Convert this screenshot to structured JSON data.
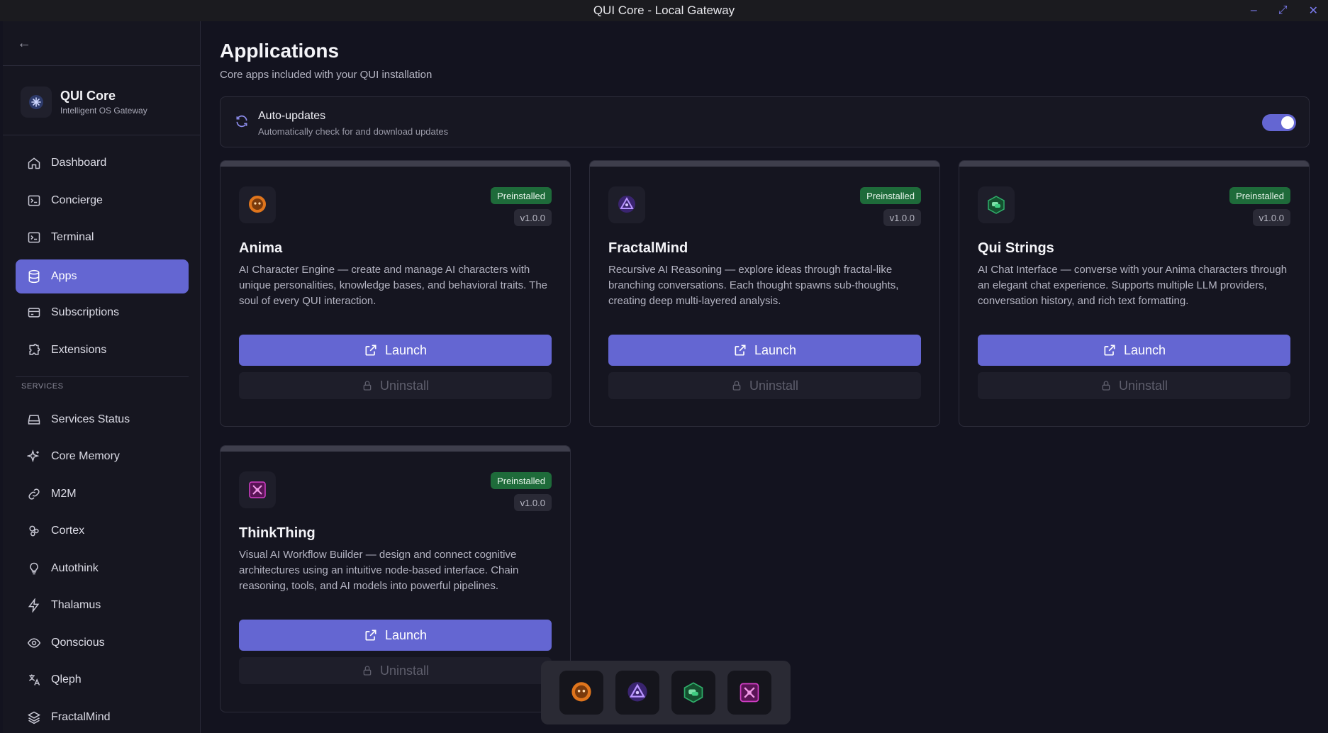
{
  "window": {
    "title": "QUI Core - Local Gateway",
    "controls": {
      "minimize": "–",
      "maximize": "⤢",
      "close": "✕"
    }
  },
  "sidebar": {
    "back_icon": "←",
    "brand": {
      "name": "QUI Core",
      "subtitle": "Intelligent OS Gateway"
    },
    "nav": [
      {
        "label": "Dashboard",
        "icon": "home-icon"
      },
      {
        "label": "Concierge",
        "icon": "terminal-box-icon"
      },
      {
        "label": "Terminal",
        "icon": "terminal-box-icon"
      },
      {
        "label": "Apps",
        "icon": "database-icon",
        "active": true
      },
      {
        "label": "Subscriptions",
        "icon": "card-icon"
      },
      {
        "label": "Extensions",
        "icon": "puzzle-icon"
      }
    ],
    "services_label": "SERVICES",
    "services": [
      {
        "label": "Services Status",
        "icon": "drive-icon"
      },
      {
        "label": "Core Memory",
        "icon": "sparkles-icon"
      },
      {
        "label": "M2M",
        "icon": "link-icon"
      },
      {
        "label": "Cortex",
        "icon": "nodes-icon"
      },
      {
        "label": "Autothink",
        "icon": "lightbulb-icon"
      },
      {
        "label": "Thalamus",
        "icon": "bolt-icon"
      },
      {
        "label": "Qonscious",
        "icon": "eye-icon"
      },
      {
        "label": "Qleph",
        "icon": "translate-icon"
      },
      {
        "label": "FractalMind",
        "icon": "layers-icon"
      }
    ]
  },
  "main": {
    "title": "Applications",
    "subtitle": "Core apps included with your QUI installation",
    "autoupdate": {
      "title": "Auto-updates",
      "description": "Automatically check for and download updates",
      "enabled": true
    },
    "apps": [
      {
        "name": "Anima",
        "badge": "Preinstalled",
        "version": "v1.0.0",
        "description": "AI Character Engine — create and manage AI characters with unique personalities, knowledge bases, and behavioral traits. The soul of every QUI interaction.",
        "launch": "Launch",
        "uninstall": "Uninstall",
        "icon": "anima-icon",
        "color": "#e0751c"
      },
      {
        "name": "FractalMind",
        "badge": "Preinstalled",
        "version": "v1.0.0",
        "description": "Recursive AI Reasoning — explore ideas through fractal-like branching conversations. Each thought spawns sub-thoughts, creating deep multi-layered analysis.",
        "launch": "Launch",
        "uninstall": "Uninstall",
        "icon": "fractalmind-icon",
        "color": "#8a5cf0"
      },
      {
        "name": "Qui Strings",
        "badge": "Preinstalled",
        "version": "v1.0.0",
        "description": "AI Chat Interface — converse with your Anima characters through an elegant chat experience. Supports multiple LLM providers, conversation history, and rich text formatting.",
        "launch": "Launch",
        "uninstall": "Uninstall",
        "icon": "quistrings-icon",
        "color": "#2fae6a"
      },
      {
        "name": "ThinkThing",
        "badge": "Preinstalled",
        "version": "v1.0.0",
        "description": "Visual AI Workflow Builder — design and connect cognitive architectures using an intuitive node-based interface. Chain reasoning, tools, and AI models into powerful pipelines.",
        "launch": "Launch",
        "uninstall": "Uninstall",
        "icon": "thinkthing-icon",
        "color": "#d43ec8"
      }
    ]
  },
  "dock": [
    {
      "icon": "anima-icon",
      "color": "#e0751c"
    },
    {
      "icon": "fractalmind-icon",
      "color": "#8a5cf0"
    },
    {
      "icon": "quistrings-icon",
      "color": "#2fae6a"
    },
    {
      "icon": "thinkthing-icon",
      "color": "#d43ec8"
    }
  ]
}
